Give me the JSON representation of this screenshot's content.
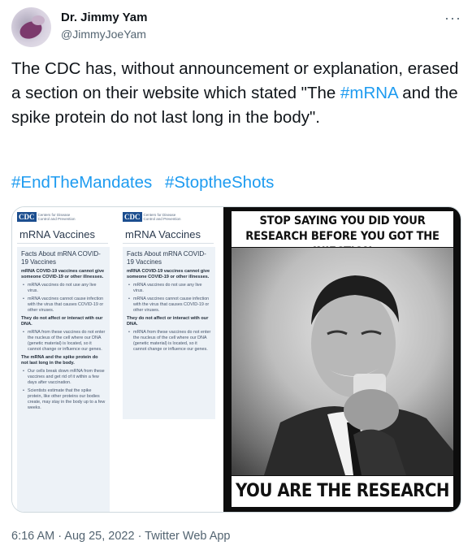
{
  "author": {
    "name": "Dr. Jimmy Yam",
    "handle": "@JimmyJoeYam"
  },
  "tweet": {
    "text_1": "The CDC has, without announcement or explanation, erased a section on their website which stated \"The ",
    "hashtag_inline": "#mRNA",
    "text_2": " and the spike protein do not last long in the body\".",
    "hashtags": [
      "#EndTheMandates",
      "#StoptheShots"
    ]
  },
  "cdc_pages": [
    {
      "logo": "CDC",
      "org": "Centers for Disease Control and Prevention",
      "title": "mRNA Vaccines",
      "panel_heading": "Facts About mRNA COVID-19 Vaccines",
      "lead": "mRNA COVID-19 vaccines cannot give someone COVID-19 or other illnesses.",
      "bullets_1": [
        "mRNA vaccines do not use any live virus.",
        "mRNA vaccines cannot cause infection with the virus that causes COVID-19 or other viruses."
      ],
      "subhead_1": "They do not affect or interact with our DNA.",
      "bullets_2": [
        "mRNA from these vaccines do not enter the nucleus of the cell where our DNA (genetic material) is located, so it cannot change or influence our genes."
      ],
      "subhead_2": "The mRNA and the spike protein do not last long in the body.",
      "bullets_3": [
        "Our cells break down mRNA from these vaccines and get rid of it within a few days after vaccination.",
        "Scientists estimate that the spike protein, like other proteins our bodies create, may stay in the body up to a few weeks."
      ]
    },
    {
      "logo": "CDC",
      "org": "Centers for Disease Control and Prevention",
      "title": "mRNA Vaccines",
      "panel_heading": "Facts About mRNA COVID-19 Vaccines",
      "lead": "mRNA COVID-19 vaccines cannot give someone COVID-19 or other illnesses.",
      "bullets_1": [
        "mRNA vaccines do not use any live virus.",
        "mRNA vaccines cannot cause infection with the virus that causes COVID-19 or other viruses."
      ],
      "subhead_1": "They do not affect or interact with our DNA.",
      "bullets_2": [
        "mRNA from these vaccines do not enter the nucleus of the cell where our DNA (genetic material) is located, so it cannot change or influence our genes."
      ]
    }
  ],
  "meme": {
    "top_text": "STOP SAYING YOU DID YOUR RESEARCH BEFORE YOU GOT THE INJECTION",
    "bottom_text": "YOU ARE THE RESEARCH"
  },
  "footer": {
    "timestamp": "6:16 AM · Aug 25, 2022 · Twitter Web App"
  },
  "icons": {
    "more": "more-horizontal-icon"
  }
}
